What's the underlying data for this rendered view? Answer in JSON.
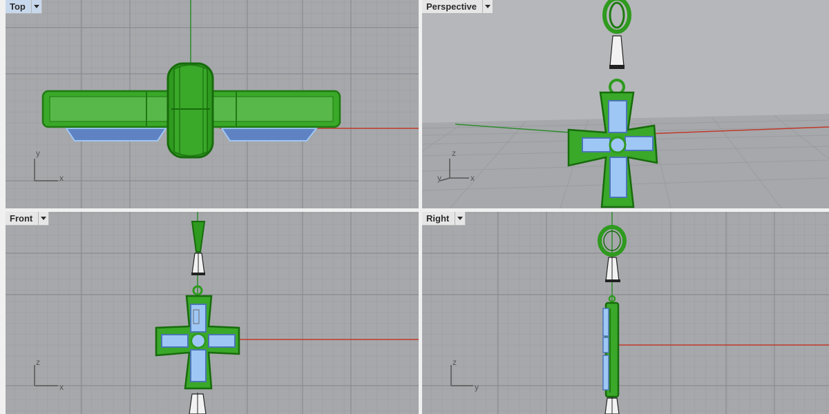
{
  "viewports": {
    "top": {
      "label": "Top",
      "axis_horizontal": "x",
      "axis_vertical": "y"
    },
    "perspective": {
      "label": "Perspective",
      "axis_x": "x",
      "axis_y": "y",
      "axis_z": "z"
    },
    "front": {
      "label": "Front",
      "axis_horizontal": "x",
      "axis_vertical": "z"
    },
    "right": {
      "label": "Right",
      "axis_horizontal": "y",
      "axis_vertical": "z"
    }
  },
  "colors": {
    "viewport_bg": "#a6a8ab",
    "grid_minor": "#9a9c9f",
    "grid_major": "#8c8e91",
    "x_axis": "#c0392b",
    "y_axis": "#2e8b2e",
    "object_green": "#2e9a1e",
    "selection_blue": "#9fc7f5",
    "viewport_border": "#d8d8d8"
  },
  "icons": {
    "viewport_menu": "chevron-down-icon",
    "cplane_axes": "axis-widget-icon"
  }
}
